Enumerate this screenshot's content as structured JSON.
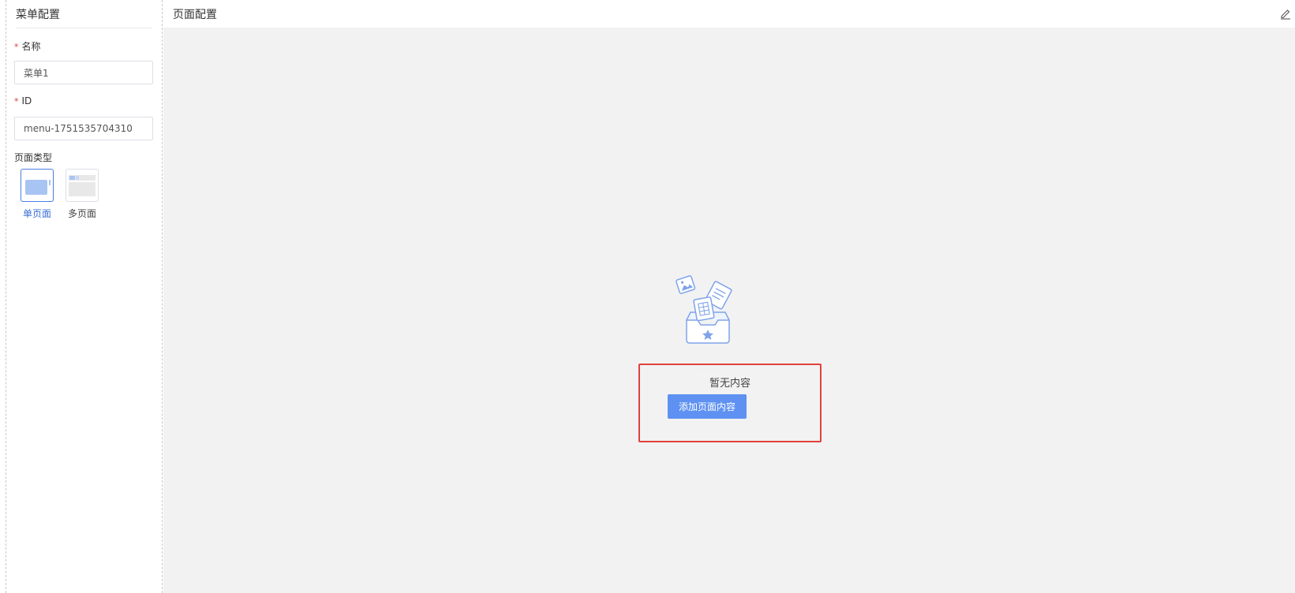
{
  "left_panel": {
    "title": "菜单配置",
    "name_field": {
      "label": "名称",
      "required_mark": "*",
      "value": "菜单1"
    },
    "id_field": {
      "label": "ID",
      "required_mark": "*",
      "value": "menu-1751535704310"
    },
    "page_type": {
      "label": "页面类型",
      "options": [
        {
          "label": "单页面",
          "selected": true,
          "icon": "single-page-icon"
        },
        {
          "label": "多页面",
          "selected": false,
          "icon": "multi-page-icon"
        }
      ]
    }
  },
  "main": {
    "title": "页面配置",
    "edit_icon": "edit-icon",
    "empty_state": {
      "illustration": "empty-inbox-icon",
      "text": "暂无内容",
      "button_label": "添加页面内容"
    }
  },
  "colors": {
    "primary": "#5e91f2",
    "highlight_border": "#e0413c",
    "required": "#e23a3a",
    "canvas_bg": "#f2f2f2"
  }
}
